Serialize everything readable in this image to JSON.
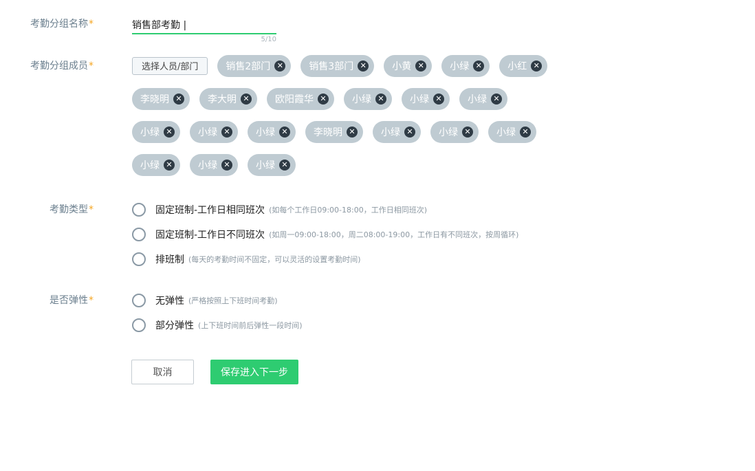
{
  "group_name": {
    "label": "考勤分组名称",
    "required_mark": "*",
    "value": "销售部考勤 |",
    "counter": "5/10"
  },
  "members": {
    "label": "考勤分组成员",
    "required_mark": "*",
    "select_button": "选择人员/部门",
    "close_glyph": "✕",
    "rows": [
      [
        "销售2部门",
        "销售3部门",
        "小黄",
        "小绿",
        "小红"
      ],
      [
        "李晓明",
        "李大明",
        "欧阳霞华",
        "小绿",
        "小绿",
        "小绿"
      ],
      [
        "小绿",
        "小绿",
        "小绿",
        "李晓明",
        "小绿",
        "小绿",
        "小绿"
      ],
      [
        "小绿",
        "小绿",
        "小绿"
      ]
    ]
  },
  "attendance_type": {
    "label": "考勤类型",
    "required_mark": "*",
    "options": [
      {
        "label": "固定班制-工作日相同班次",
        "hint": "(如每个工作日09:00-18:00，工作日相同班次)"
      },
      {
        "label": "固定班制-工作日不同班次",
        "hint": "(如周一09:00-18:00，周二08:00-19:00，工作日有不同班次，按周循环)"
      },
      {
        "label": "排班制",
        "hint": "(每天的考勤时间不固定，可以灵活的设置考勤时间)"
      }
    ]
  },
  "flexibility": {
    "label": "是否弹性",
    "required_mark": "*",
    "options": [
      {
        "label": "无弹性",
        "hint": "(严格按照上下班时间考勤)"
      },
      {
        "label": "部分弹性",
        "hint": "(上下班时间前后弹性一段时间)"
      }
    ]
  },
  "actions": {
    "cancel": "取消",
    "save": "保存进入下一步"
  },
  "colors": {
    "accent": "#2ecc71",
    "tag_bg": "#bfcbd2",
    "required": "#f5a623"
  }
}
